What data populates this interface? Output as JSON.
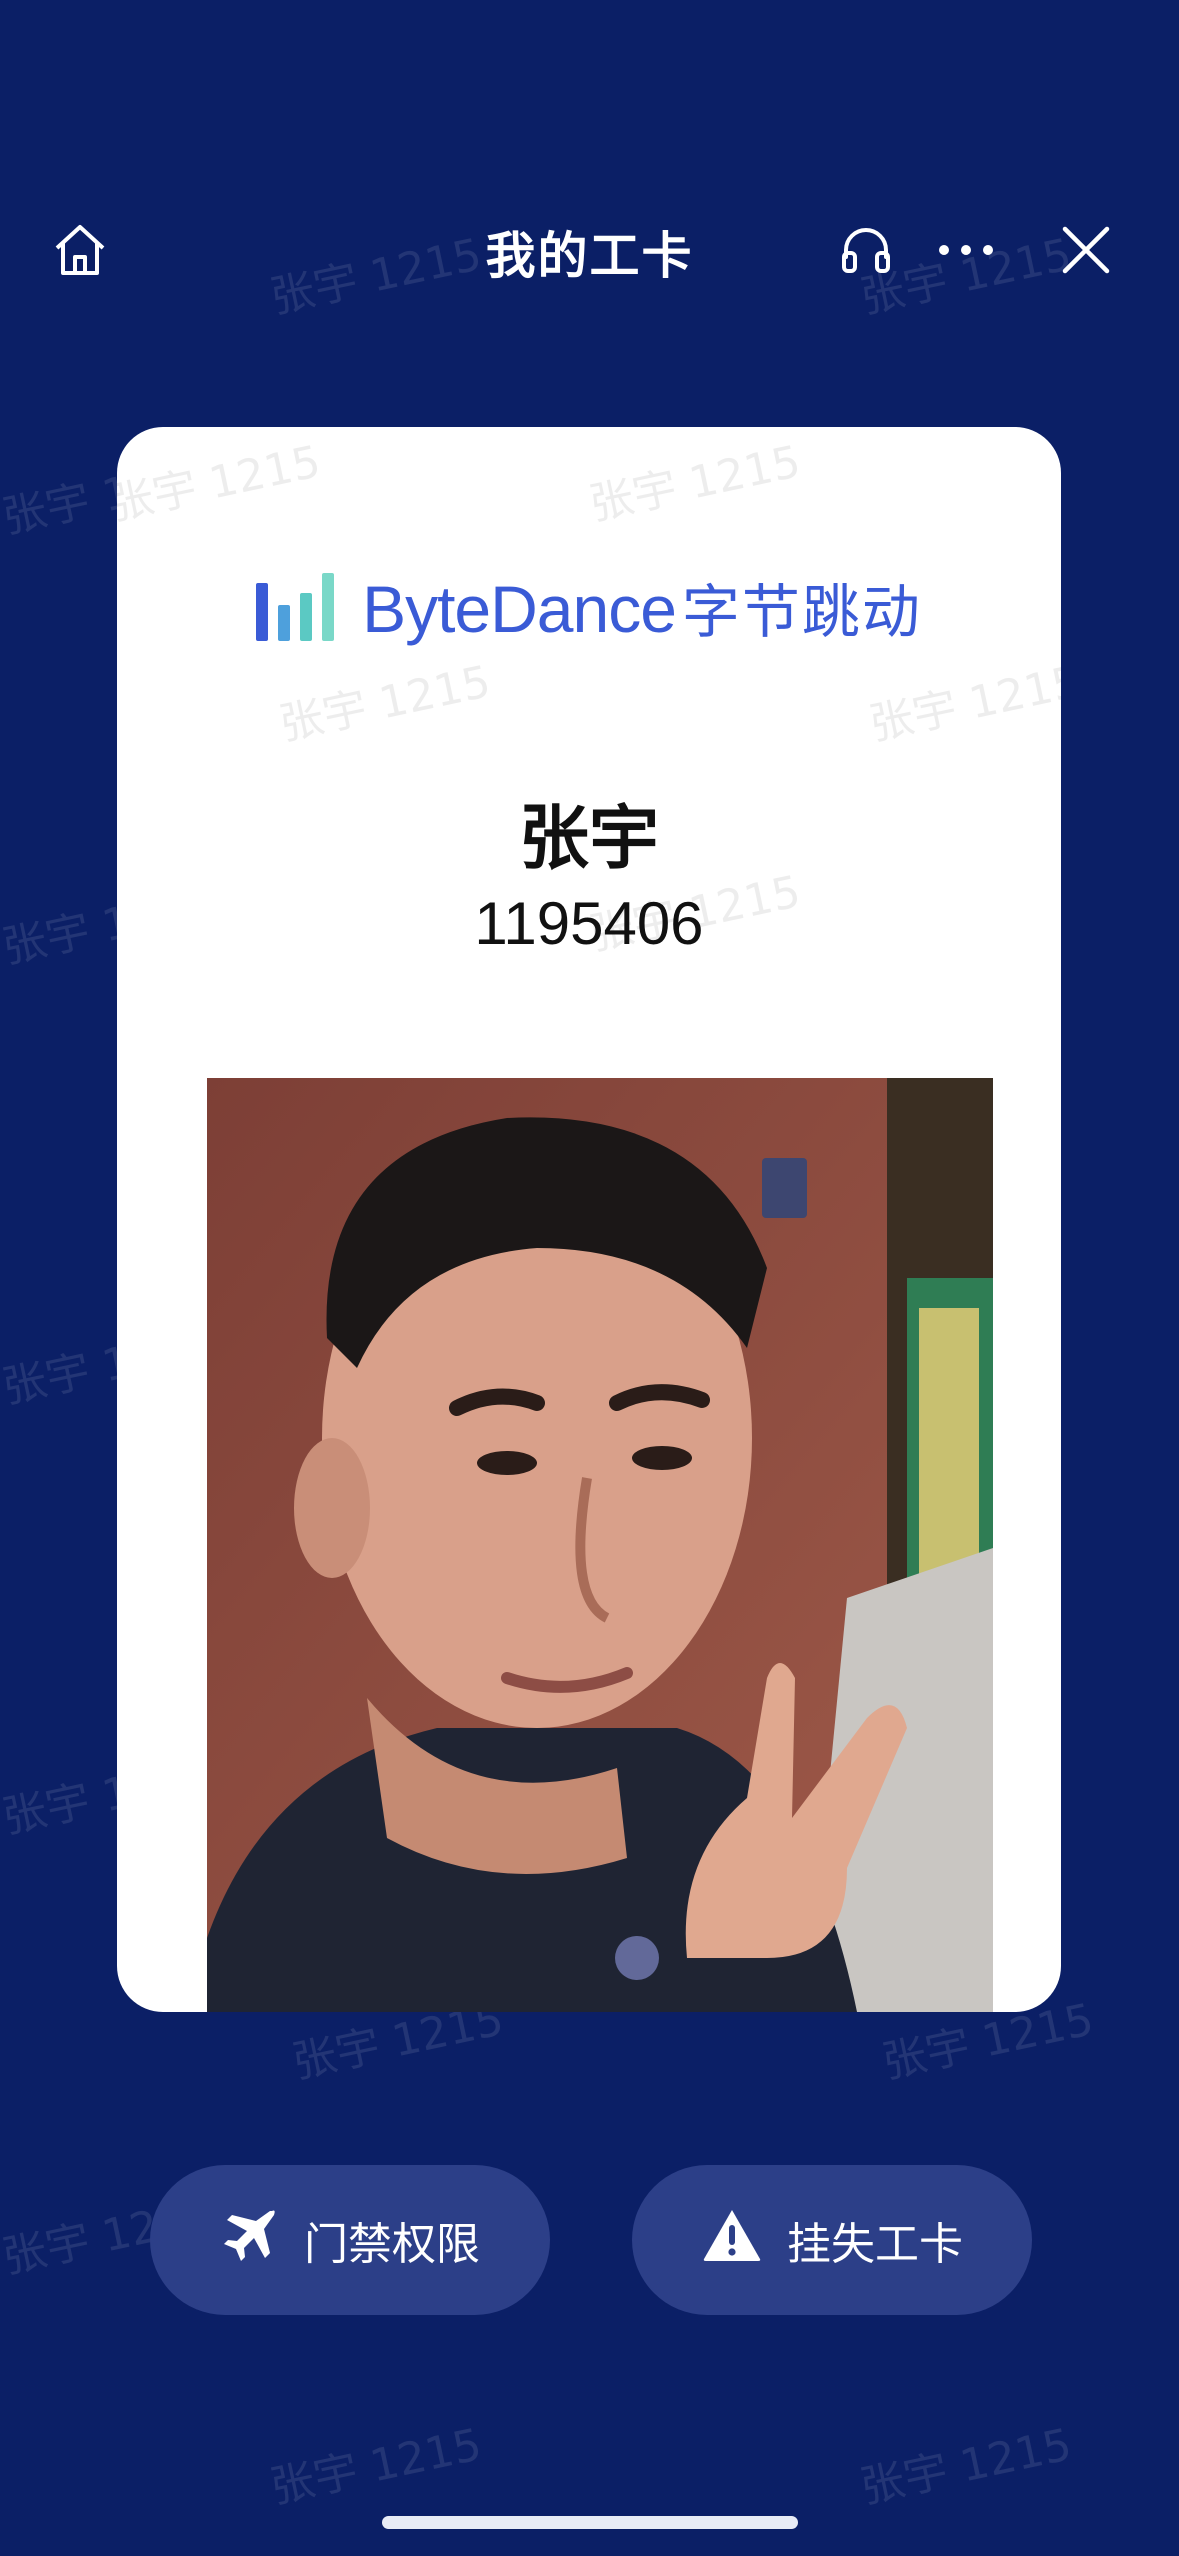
{
  "header": {
    "title": "我的工卡",
    "home_icon": "home-icon",
    "headset_icon": "headset-icon",
    "more_icon": "more-icon",
    "close_icon": "close-icon"
  },
  "card": {
    "logo": {
      "text": "ByteDance",
      "text_cn": "字节跳动",
      "bar_colors": [
        "#3a5bd6",
        "#4ea0dc",
        "#5bc9c3",
        "#7ad8c8"
      ]
    },
    "name": "张宇",
    "employee_id": "1195406",
    "photo": {
      "alt": "employee-photo"
    }
  },
  "actions": {
    "access_label": "门禁权限",
    "access_icon": "airplane-icon",
    "report_label": "挂失工卡",
    "report_icon": "warning-icon"
  },
  "watermark": {
    "text": "张宇 1215"
  },
  "colors": {
    "background": "#0b1f66",
    "button": "#2c3f88",
    "brand": "#3a5bd6"
  }
}
